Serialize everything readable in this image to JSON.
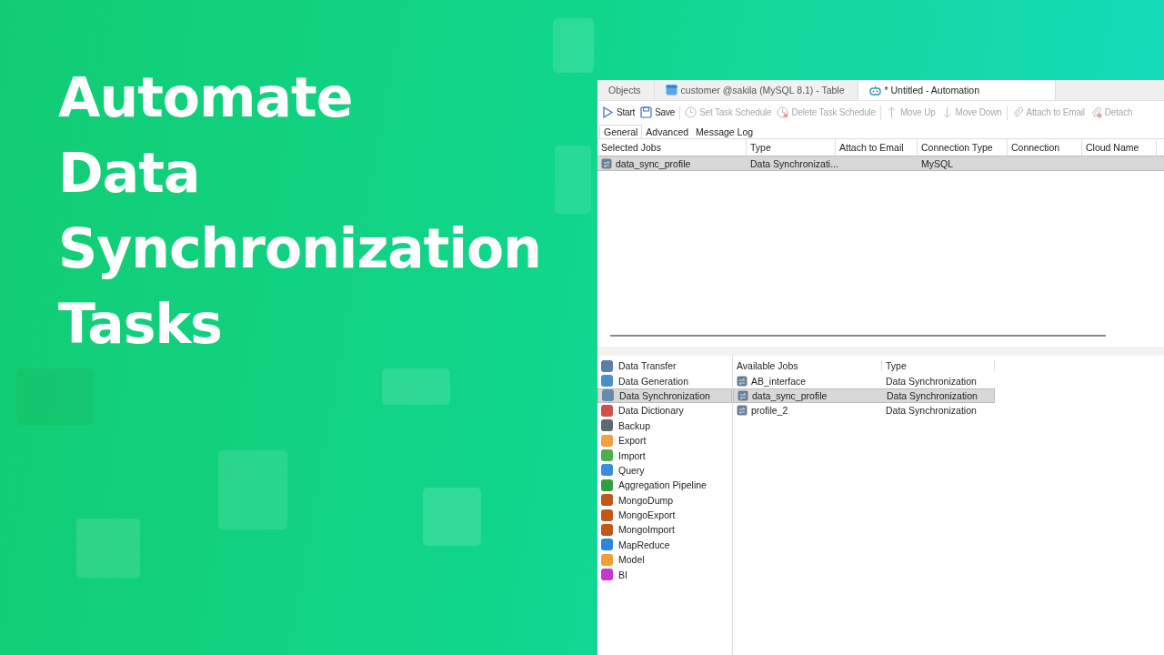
{
  "headline": [
    "Automate",
    "Data",
    "Synchronization",
    "Tasks"
  ],
  "window": {
    "tabs": [
      {
        "label": "Objects",
        "kind": "plain",
        "selected": false
      },
      {
        "label": "customer @sakila (MySQL 8.1) - Table",
        "kind": "table",
        "selected": false
      },
      {
        "label": "* Untitled - Automation",
        "kind": "robot",
        "selected": true
      }
    ],
    "toolbar": [
      {
        "label": "Start",
        "kind": "play",
        "disabled": false
      },
      {
        "label": "Save",
        "kind": "save",
        "disabled": false
      },
      {
        "label": "Set Task Schedule",
        "kind": "clock",
        "disabled": true
      },
      {
        "label": "Delete Task Schedule",
        "kind": "clock-x",
        "disabled": true
      },
      {
        "label": "Move Up",
        "kind": "up",
        "disabled": true
      },
      {
        "label": "Move Down",
        "kind": "down",
        "disabled": true
      },
      {
        "label": "Attach to Email",
        "kind": "clip",
        "disabled": true
      },
      {
        "label": "Detach",
        "kind": "clip-x",
        "disabled": true
      }
    ],
    "subtabs": [
      {
        "label": "General",
        "selected": true
      },
      {
        "label": "Advanced",
        "selected": false
      },
      {
        "label": "Message Log",
        "selected": false
      }
    ],
    "selected_jobs": {
      "columns": [
        "Selected Jobs",
        "Type",
        "Attach to Email",
        "Connection Type",
        "Connection",
        "Cloud Name"
      ],
      "rows": [
        {
          "job": "data_sync_profile",
          "type": "Data Synchronizati...",
          "connection_type": "MySQL",
          "selected": true
        }
      ]
    },
    "categories": [
      {
        "label": "Data Transfer",
        "color": "#5b7fa6",
        "selected": false
      },
      {
        "label": "Data Generation",
        "color": "#4a90c8",
        "selected": false
      },
      {
        "label": "Data Synchronization",
        "color": "#6a8aa8",
        "selected": true
      },
      {
        "label": "Data Dictionary",
        "color": "#d05050",
        "selected": false
      },
      {
        "label": "Backup",
        "color": "#606870",
        "selected": false
      },
      {
        "label": "Export",
        "color": "#f0a040",
        "selected": false
      },
      {
        "label": "Import",
        "color": "#4cae4c",
        "selected": false
      },
      {
        "label": "Query",
        "color": "#3a8ee0",
        "selected": false
      },
      {
        "label": "Aggregation Pipeline",
        "color": "#2e9e3e",
        "selected": false
      },
      {
        "label": "MongoDump",
        "color": "#c0581a",
        "selected": false
      },
      {
        "label": "MongoExport",
        "color": "#c0581a",
        "selected": false
      },
      {
        "label": "MongoImport",
        "color": "#c0581a",
        "selected": false
      },
      {
        "label": "MapReduce",
        "color": "#2f86d8",
        "selected": false
      },
      {
        "label": "Model",
        "color": "#f0a030",
        "selected": false
      },
      {
        "label": "BI",
        "color": "#c838c8",
        "selected": false
      }
    ],
    "available_jobs": {
      "columns": [
        "Available Jobs",
        "Type"
      ],
      "rows": [
        {
          "job": "AB_interface",
          "type": "Data Synchronization",
          "selected": false
        },
        {
          "job": "data_sync_profile",
          "type": "Data Synchronization",
          "selected": true
        },
        {
          "job": "profile_2",
          "type": "Data Synchronization",
          "selected": false
        }
      ]
    }
  }
}
